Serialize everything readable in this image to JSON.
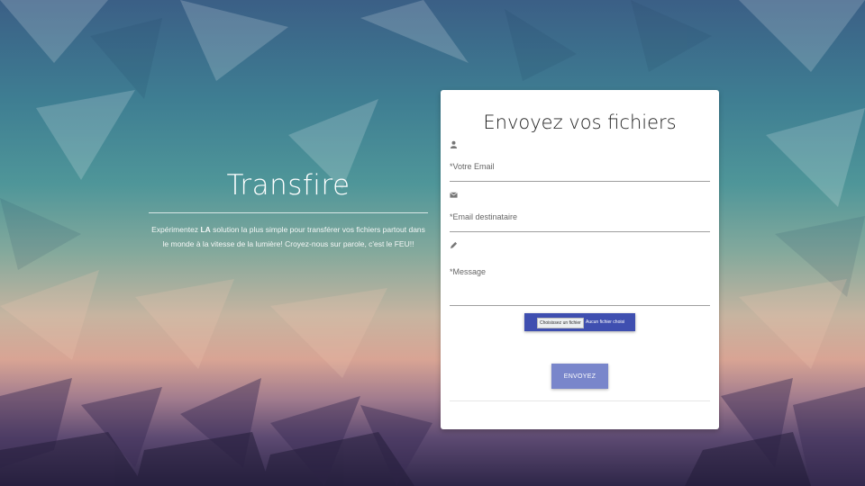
{
  "hero": {
    "title": "Transfire",
    "desc_pre": "Expérimentez ",
    "desc_bold": "LA",
    "desc_post": " solution la plus simple pour transférer vos fichiers partout dans le monde à la vitesse de la lumière! Croyez-nous sur parole, c'est le FEU!!"
  },
  "form": {
    "title": "Envoyez vos fichiers",
    "email_placeholder": "*Votre Email",
    "recipient_placeholder": "*Email destinataire",
    "message_placeholder": "*Message",
    "file_choose_label": "Choisissez un fichier",
    "file_none_label": "Aucun fichier choisi",
    "submit_label": "ENVOYEZ",
    "icons": [
      "user-icon",
      "envelope-icon",
      "pencil-icon"
    ]
  },
  "colors": {
    "file_button": "#3f4fb0",
    "submit_button": "#7986cb"
  }
}
